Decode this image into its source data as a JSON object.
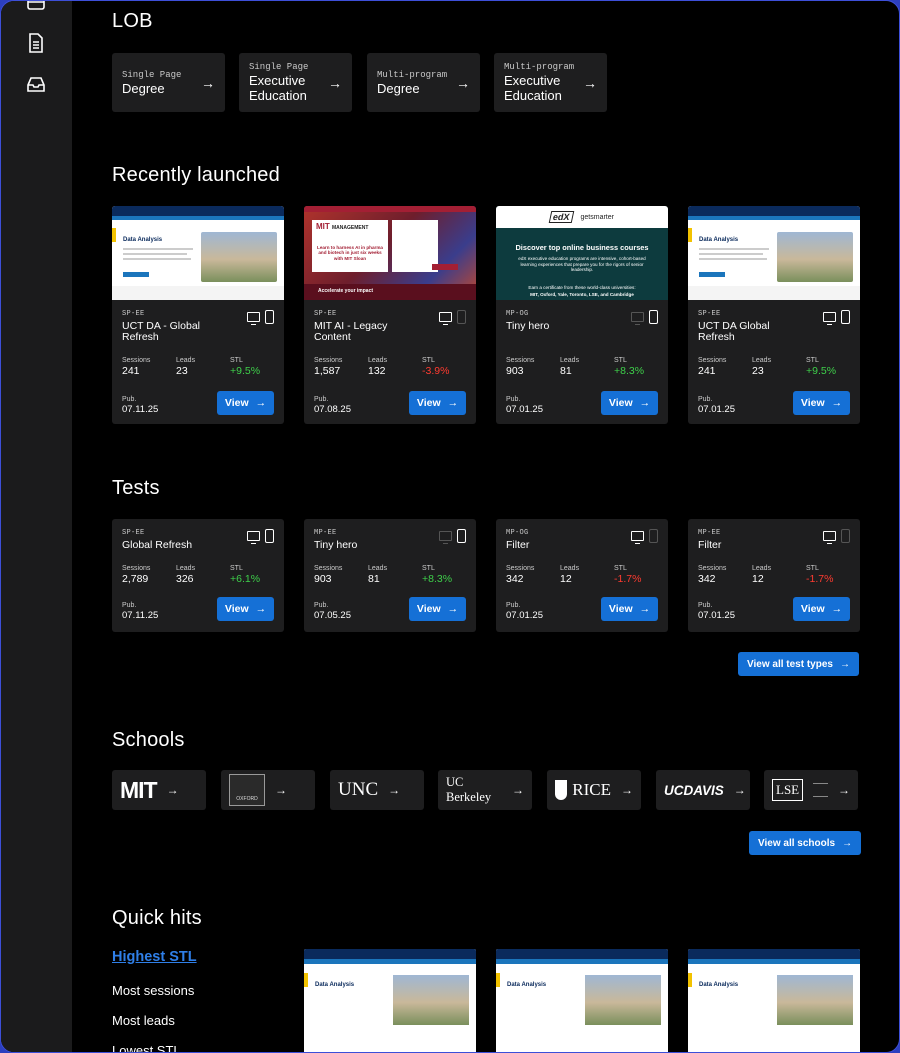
{
  "sections": {
    "lob": "LOB",
    "recent": "Recently launched",
    "tests": "Tests",
    "schools": "Schools",
    "quick": "Quick hits"
  },
  "lob": [
    {
      "small": "Single Page",
      "big": "Degree"
    },
    {
      "small": "Single Page",
      "big": "Executive Education"
    },
    {
      "small": "Multi-program",
      "big": "Degree"
    },
    {
      "small": "Multi-program",
      "big": "Executive Education"
    }
  ],
  "recent": [
    {
      "code": "SP-EE",
      "title": "UCT DA - Global Refresh",
      "sessions": "241",
      "leads": "23",
      "stl": "+9.5%",
      "date": "07.11.25"
    },
    {
      "code": "SP-EE",
      "title": "MIT AI - Legacy Content",
      "sessions": "1,587",
      "leads": "132",
      "stl": "-3.9%",
      "date": "07.08.25"
    },
    {
      "code": "MP-OG",
      "title": "Tiny hero",
      "sessions": "903",
      "leads": "81",
      "stl": "+8.3%",
      "date": "07.01.25"
    },
    {
      "code": "SP-EE",
      "title": "UCT DA Global Refresh",
      "sessions": "241",
      "leads": "23",
      "stl": "+9.5%",
      "date": "07.01.25"
    }
  ],
  "tests": [
    {
      "code": "SP-EE",
      "title": "Global Refresh",
      "sessions": "2,789",
      "leads": "326",
      "stl": "+6.1%",
      "date": "07.11.25"
    },
    {
      "code": "MP-EE",
      "title": "Tiny hero",
      "sessions": "903",
      "leads": "81",
      "stl": "+8.3%",
      "date": "07.05.25"
    },
    {
      "code": "MP-OG",
      "title": "Filter",
      "sessions": "342",
      "leads": "12",
      "stl": "-1.7%",
      "date": "07.01.25"
    },
    {
      "code": "MP-EE",
      "title": "Filter",
      "sessions": "342",
      "leads": "12",
      "stl": "-1.7%",
      "date": "07.01.25"
    }
  ],
  "labels": {
    "sessions": "Sessions",
    "leads": "Leads",
    "stl": "STL",
    "pub": "Pub.",
    "view": "View"
  },
  "buttons": {
    "all_tests": "View all test types",
    "all_schools": "View all schools"
  },
  "schools": [
    "MIT",
    "OXFORD",
    "UNC",
    "UC Berkeley",
    "RICE",
    "UCDAVIS",
    "LSE"
  ],
  "quick_hits": [
    "Highest STL",
    "Most sessions",
    "Most leads",
    "Lowest STL"
  ],
  "thumbs": {
    "uct": {
      "heading": "Data Analysis"
    },
    "mit": {
      "brand": "MIT",
      "sub": "MANAGEMENT",
      "headline": "Learn to harness AI in pharma and biotech in just six weeks with MIT Sloan",
      "bar": "Accelerate your impact"
    },
    "edx": {
      "logo": "edX",
      "partner": "getsmarter",
      "headline": "Discover top online business courses",
      "body": "edX executive education programs are intensive, cohort-based learning experiences that prepare you for the rigors of senior leadership.",
      "foot": "Earn a certificate from these world-class universities:",
      "schools": "MIT, Oxford, Yale, Toronto, LSE, and Cambridge"
    }
  },
  "colors": {
    "accent": "#1570d6",
    "positive": "#3ecf4a",
    "negative": "#ff3b30",
    "card": "#1e1e1f"
  }
}
